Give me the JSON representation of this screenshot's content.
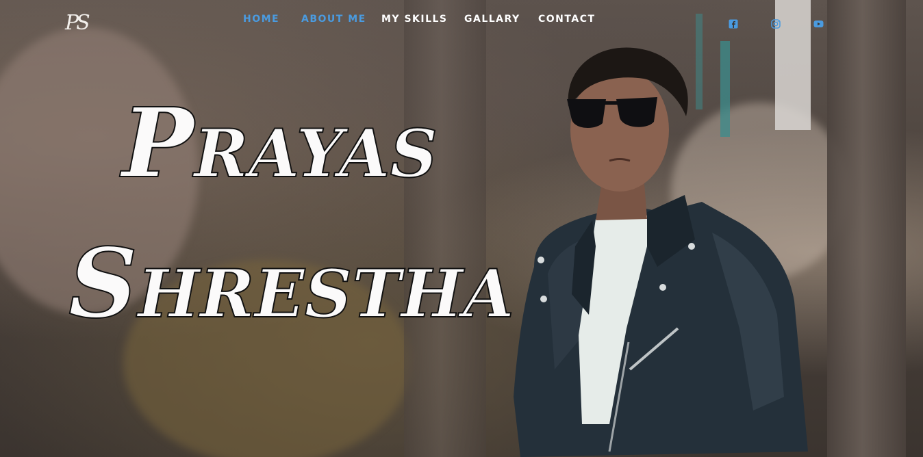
{
  "logo": {
    "text": "PS"
  },
  "nav": {
    "items": [
      {
        "label": "HOME",
        "active": true
      },
      {
        "label": "ABOUT ME",
        "active": true
      },
      {
        "label": "MY SKILLS",
        "active": false
      },
      {
        "label": "GALLARY",
        "active": false
      },
      {
        "label": "CONTACT",
        "active": false
      }
    ]
  },
  "social": {
    "icons": [
      "facebook-icon",
      "instagram-icon",
      "youtube-icon"
    ],
    "color": "#4a9be0"
  },
  "hero": {
    "first_name_initial": "P",
    "first_name_rest": "RAYAS",
    "last_name_initial": "S",
    "last_name_rest": "HRESTHA"
  },
  "colors": {
    "accent": "#4a9be0",
    "nav_text": "#ffffff",
    "name_fill": "#fbfafa",
    "name_outline": "#111111"
  }
}
